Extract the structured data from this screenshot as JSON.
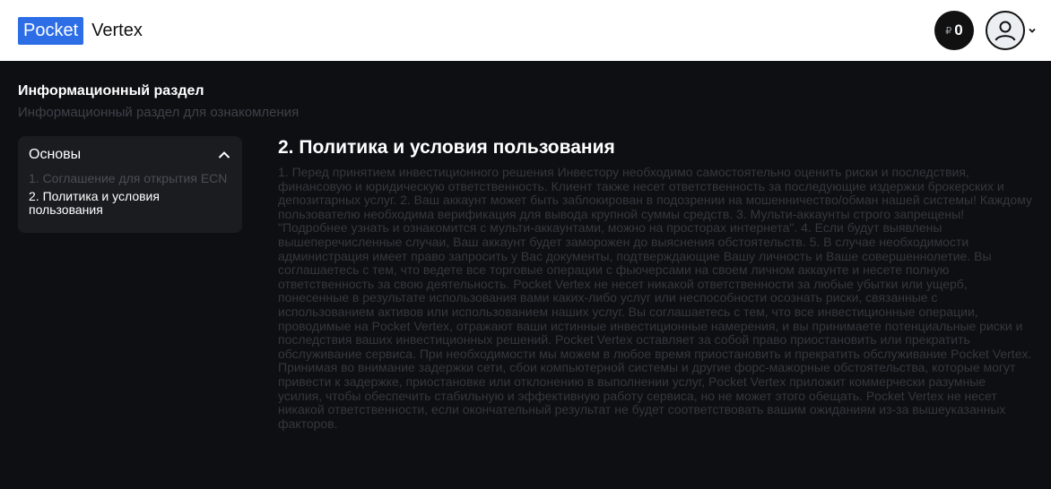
{
  "header": {
    "logo_box": "Pocket",
    "logo_text": "Vertex",
    "balance_currency": "₽",
    "balance_value": "0"
  },
  "section": {
    "title": "Информационный раздел",
    "subtitle": "Информационный раздел для ознакомления"
  },
  "sidebar": {
    "title": "Основы",
    "items": [
      {
        "label": "1. Соглашение для открытия ECN",
        "active": false
      },
      {
        "label": "2. Политика и условия пользования",
        "active": true
      }
    ]
  },
  "article": {
    "title": "2. Политика и условия пользования",
    "body": "1. Перед принятием инвестиционного решения Инвестору необходимо самостоятельно оценить риски и последствия, финансовую и юридическую ответственность. Клиент также несет ответственность за последующие издержки брокерских и депозитарных услуг. 2. Ваш аккаунт может быть заблокирован в подозрении на мошенничество/обман нашей системы! Каждому пользователю необходима верификация для вывода крупной суммы средств. 3. Мульти-аккаунты строго запрещены! \"Подробнее узнать и ознакомится с мульти-аккаунтами, можно на просторах интернета\". 4. Если будут выявлены вышеперечисленные случаи, Ваш аккаунт будет заморожен до выяснения обстоятельств. 5. В случае необходимости администрация имеет право запросить у Вас документы, подтверждающие Вашу личность и Ваше совершеннолетие. Вы соглашаетесь с тем, что ведете все торговые операции с фьючерсами на своем личном аккаунте и несете полную ответственность за свою деятельность. Pocket Vertex не несет никакой ответственности за любые убытки или ущерб, понесенные в результате использования вами каких-либо услуг или неспособности осознать риски, связанные с использованием активов или использованием наших услуг. Вы соглашаетесь с тем, что все инвестиционные операции, проводимые на Pocket Vertex, отражают ваши истинные инвестиционные намерения, и вы принимаете потенциальные риски и последствия ваших инвестиционных решений. Pocket Vertex оставляет за собой право приостановить или прекратить обслуживание сервиса. При необходимости мы можем в любое время приостановить и прекратить обслуживание Pocket Vertex. Принимая во внимание задержки сети, сбои компьютерной системы и другие форс-мажорные обстоятельства, которые могут привести к задержке, приостановке или отклонению в выполнении услуг, Pocket Vertex приложит коммерчески разумные усилия, чтобы обеспечить стабильную и эффективную работу сервиса, но не может этого обещать. Pocket Vertex не несет никакой ответственности, если окончательный результат не будет соответствовать вашим ожиданиям из-за вышеуказанных факторов."
  },
  "icons": {
    "avatar": "user-circle-icon",
    "dropdown": "chevron-down-icon",
    "collapse": "chevron-up-icon"
  },
  "colors": {
    "brand": "#2d6ee6",
    "background": "#0e0f13",
    "panel": "#1b1c20"
  }
}
